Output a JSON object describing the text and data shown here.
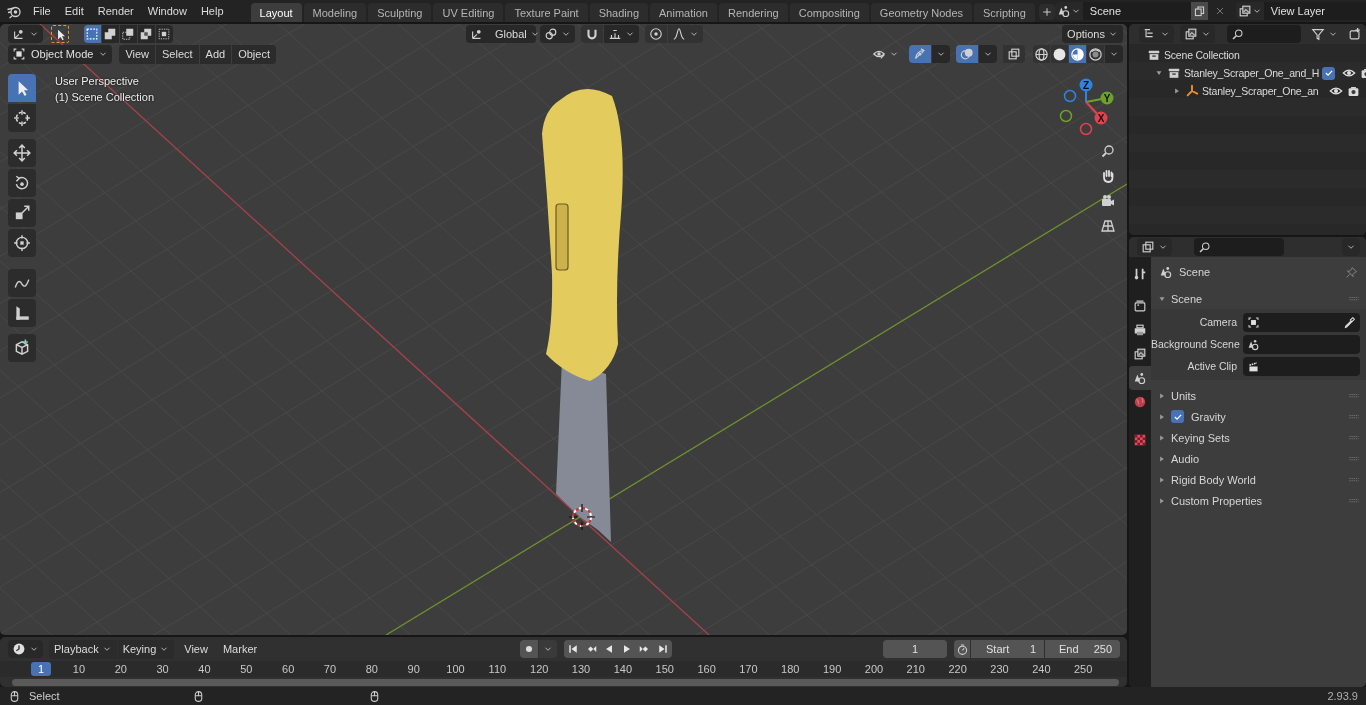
{
  "top_bar": {
    "menus": [
      "File",
      "Edit",
      "Render",
      "Window",
      "Help"
    ],
    "workspace_tabs": [
      {
        "label": "Layout",
        "selected": true
      },
      {
        "label": "Modeling",
        "selected": false
      },
      {
        "label": "Sculpting",
        "selected": false
      },
      {
        "label": "UV Editing",
        "selected": false
      },
      {
        "label": "Texture Paint",
        "selected": false
      },
      {
        "label": "Shading",
        "selected": false
      },
      {
        "label": "Animation",
        "selected": false
      },
      {
        "label": "Rendering",
        "selected": false
      },
      {
        "label": "Compositing",
        "selected": false
      },
      {
        "label": "Geometry Nodes",
        "selected": false
      },
      {
        "label": "Scripting",
        "selected": false
      }
    ],
    "scene": "Scene",
    "view_layer": "View Layer"
  },
  "viewport": {
    "select_modes": [
      {
        "kind": "set",
        "selected": true
      },
      {
        "kind": "extend",
        "selected": false
      },
      {
        "kind": "subtract",
        "selected": false
      },
      {
        "kind": "difference",
        "selected": false
      },
      {
        "kind": "intersect",
        "selected": false
      }
    ],
    "transform_orientation": "Global",
    "options": "Options",
    "mode": "Object Mode",
    "menus": [
      "View",
      "Select",
      "Add",
      "Object"
    ],
    "toggles": [
      {
        "kind": "gizmos",
        "on": true
      },
      {
        "kind": "overlays",
        "on": true
      },
      {
        "kind": "xray",
        "on": false
      }
    ],
    "shading": [
      {
        "kind": "wireframe",
        "selected": false
      },
      {
        "kind": "solid",
        "selected": false
      },
      {
        "kind": "material",
        "selected": true
      },
      {
        "kind": "rendered",
        "selected": false
      }
    ],
    "tools": [
      {
        "kind": "select",
        "selected": true
      },
      {
        "kind": "cursor",
        "selected": false
      },
      {
        "kind": "move",
        "selected": false
      },
      {
        "kind": "rotate",
        "selected": false
      },
      {
        "kind": "scale",
        "selected": false
      },
      {
        "kind": "transform",
        "selected": false
      },
      {
        "kind": "annotate",
        "selected": false
      },
      {
        "kind": "measure",
        "selected": false
      },
      {
        "kind": "add_cube",
        "selected": false
      }
    ],
    "info": [
      "User Perspective",
      "(1) Scene Collection"
    ],
    "gizmo_axes": [
      {
        "label": "Z",
        "color": "#2f84e3"
      },
      {
        "label": "Y",
        "color": "#6ca12a"
      },
      {
        "label": "X",
        "color": "#e0424f"
      }
    ]
  },
  "outliner": {
    "tree": [
      {
        "label": "Scene Collection",
        "kind": "scene_collection",
        "children": [
          {
            "label": "Stanley_Scraper_One_and_H",
            "kind": "collection",
            "expanded": true,
            "checked": true,
            "children": [
              {
                "label": "Stanley_Scraper_One_an",
                "kind": "empty",
                "expanded": false
              }
            ]
          }
        ]
      }
    ]
  },
  "properties": {
    "tabs": [
      {
        "kind": "tool",
        "selected": false
      },
      {
        "kind": "render",
        "selected": false
      },
      {
        "kind": "output",
        "selected": false
      },
      {
        "kind": "view_layer",
        "selected": false
      },
      {
        "kind": "scene",
        "selected": true
      },
      {
        "kind": "world",
        "selected": false
      },
      {
        "kind": "texture",
        "selected": false
      }
    ],
    "context": "Scene",
    "panels": [
      {
        "title": "Scene",
        "expanded": true,
        "fields": [
          {
            "label": "Camera",
            "kind": "object"
          },
          {
            "label": "Background Scene",
            "kind": "scene"
          },
          {
            "label": "Active Clip",
            "kind": "clip"
          }
        ]
      },
      {
        "title": "Units",
        "expanded": false
      },
      {
        "title": "Gravity",
        "expanded": false,
        "checked": true
      },
      {
        "title": "Keying Sets",
        "expanded": false
      },
      {
        "title": "Audio",
        "expanded": false
      },
      {
        "title": "Rigid Body World",
        "expanded": false
      },
      {
        "title": "Custom Properties",
        "expanded": false
      }
    ]
  },
  "timeline": {
    "menus": [
      {
        "label": "Playback",
        "kind": "dropdown"
      },
      {
        "label": "Keying",
        "kind": "dropdown"
      },
      {
        "label": "View",
        "kind": "menu"
      },
      {
        "label": "Marker",
        "kind": "menu"
      }
    ],
    "current_frame": "1",
    "start_label": "Start",
    "start": "1",
    "end_label": "End",
    "end": "250",
    "ruler": [
      {
        "label": "1",
        "selected": true
      },
      {
        "label": "10",
        "selected": false
      },
      {
        "label": "20",
        "selected": false
      },
      {
        "label": "30",
        "selected": false
      },
      {
        "label": "40",
        "selected": false
      },
      {
        "label": "50",
        "selected": false
      },
      {
        "label": "60",
        "selected": false
      },
      {
        "label": "70",
        "selected": false
      },
      {
        "label": "80",
        "selected": false
      },
      {
        "label": "90",
        "selected": false
      },
      {
        "label": "100",
        "selected": false
      },
      {
        "label": "110",
        "selected": false
      },
      {
        "label": "120",
        "selected": false
      },
      {
        "label": "130",
        "selected": false
      },
      {
        "label": "140",
        "selected": false
      },
      {
        "label": "150",
        "selected": false
      },
      {
        "label": "160",
        "selected": false
      },
      {
        "label": "170",
        "selected": false
      },
      {
        "label": "180",
        "selected": false
      },
      {
        "label": "190",
        "selected": false
      },
      {
        "label": "200",
        "selected": false
      },
      {
        "label": "210",
        "selected": false
      },
      {
        "label": "220",
        "selected": false
      },
      {
        "label": "230",
        "selected": false
      },
      {
        "label": "240",
        "selected": false
      },
      {
        "label": "250",
        "selected": false
      }
    ]
  },
  "status_bar": {
    "hint": "Select",
    "version": "2.93.9"
  }
}
